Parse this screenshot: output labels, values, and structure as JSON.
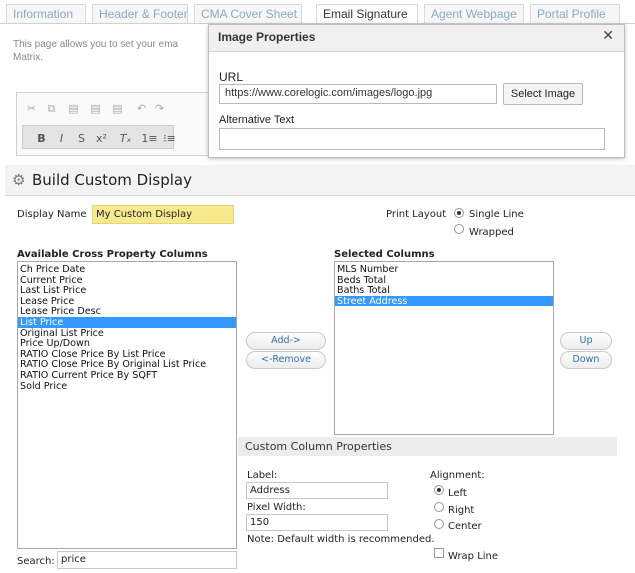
{
  "tabs": [
    "Information",
    "Header & Footer",
    "CMA Cover Sheet",
    "Email Signature",
    "Agent Webpage",
    "Portal Profile"
  ],
  "active_tab": "Email Signature",
  "intro_text": [
    "This page allows you to set your ema",
    "Matrix."
  ],
  "editor_toolbar": {
    "row1": [
      "cut-icon",
      "copy-icon",
      "paste-icon",
      "paste-text-icon",
      "paste-word-icon",
      "undo-icon",
      "redo-icon"
    ],
    "row2": {
      "bold": "B",
      "italic": "I",
      "strike": "S",
      "superscript": "x²",
      "remove_format": "Tₓ",
      "numbered_list": "1≡",
      "bulleted_list": "⁝≡"
    }
  },
  "image_dialog": {
    "title": "Image Properties",
    "url_label": "URL",
    "url_value": "https://www.corelogic.com/images/logo.jpg",
    "select_button": "Select Image",
    "alt_label": "Alternative Text",
    "alt_value": ""
  },
  "builder": {
    "title": "Build Custom Display",
    "display_name_label": "Display Name",
    "display_name_value": "My Custom Display",
    "print_layout_label": "Print Layout",
    "print_layout_options": [
      "Single Line",
      "Wrapped"
    ],
    "print_layout_selected": "Single Line",
    "available_header": "Available Cross Property Columns",
    "available_items": [
      "Ch Price Date",
      "Current Price",
      "Last List Price",
      "Lease Price",
      "Lease Price Desc",
      "List Price",
      "Original List Price",
      "Price Up/Down",
      "RATIO Close Price By List Price",
      "RATIO Close Price By Original List Price",
      "RATIO Current Price By SQFT",
      "Sold Price"
    ],
    "available_selected": "List Price",
    "selected_header": "Selected Columns",
    "selected_items": [
      "MLS Number",
      "Beds Total",
      "Baths Total",
      "Street Address"
    ],
    "selected_selected": "Street Address",
    "add_button": "Add->",
    "remove_button": "<-Remove",
    "up_button": "Up",
    "down_button": "Down",
    "search_label": "Search:",
    "search_value": "price",
    "custom_props": {
      "title": "Custom Column Properties",
      "label_label": "Label:",
      "label_value": "Address",
      "width_label": "Pixel Width:",
      "width_value": "150",
      "note": "Note: Default width is recommended.",
      "alignment_label": "Alignment:",
      "alignment_options": [
        "Left",
        "Right",
        "Center"
      ],
      "alignment_selected": "Left",
      "wrap_label": "Wrap Line",
      "wrap_checked": false
    }
  }
}
